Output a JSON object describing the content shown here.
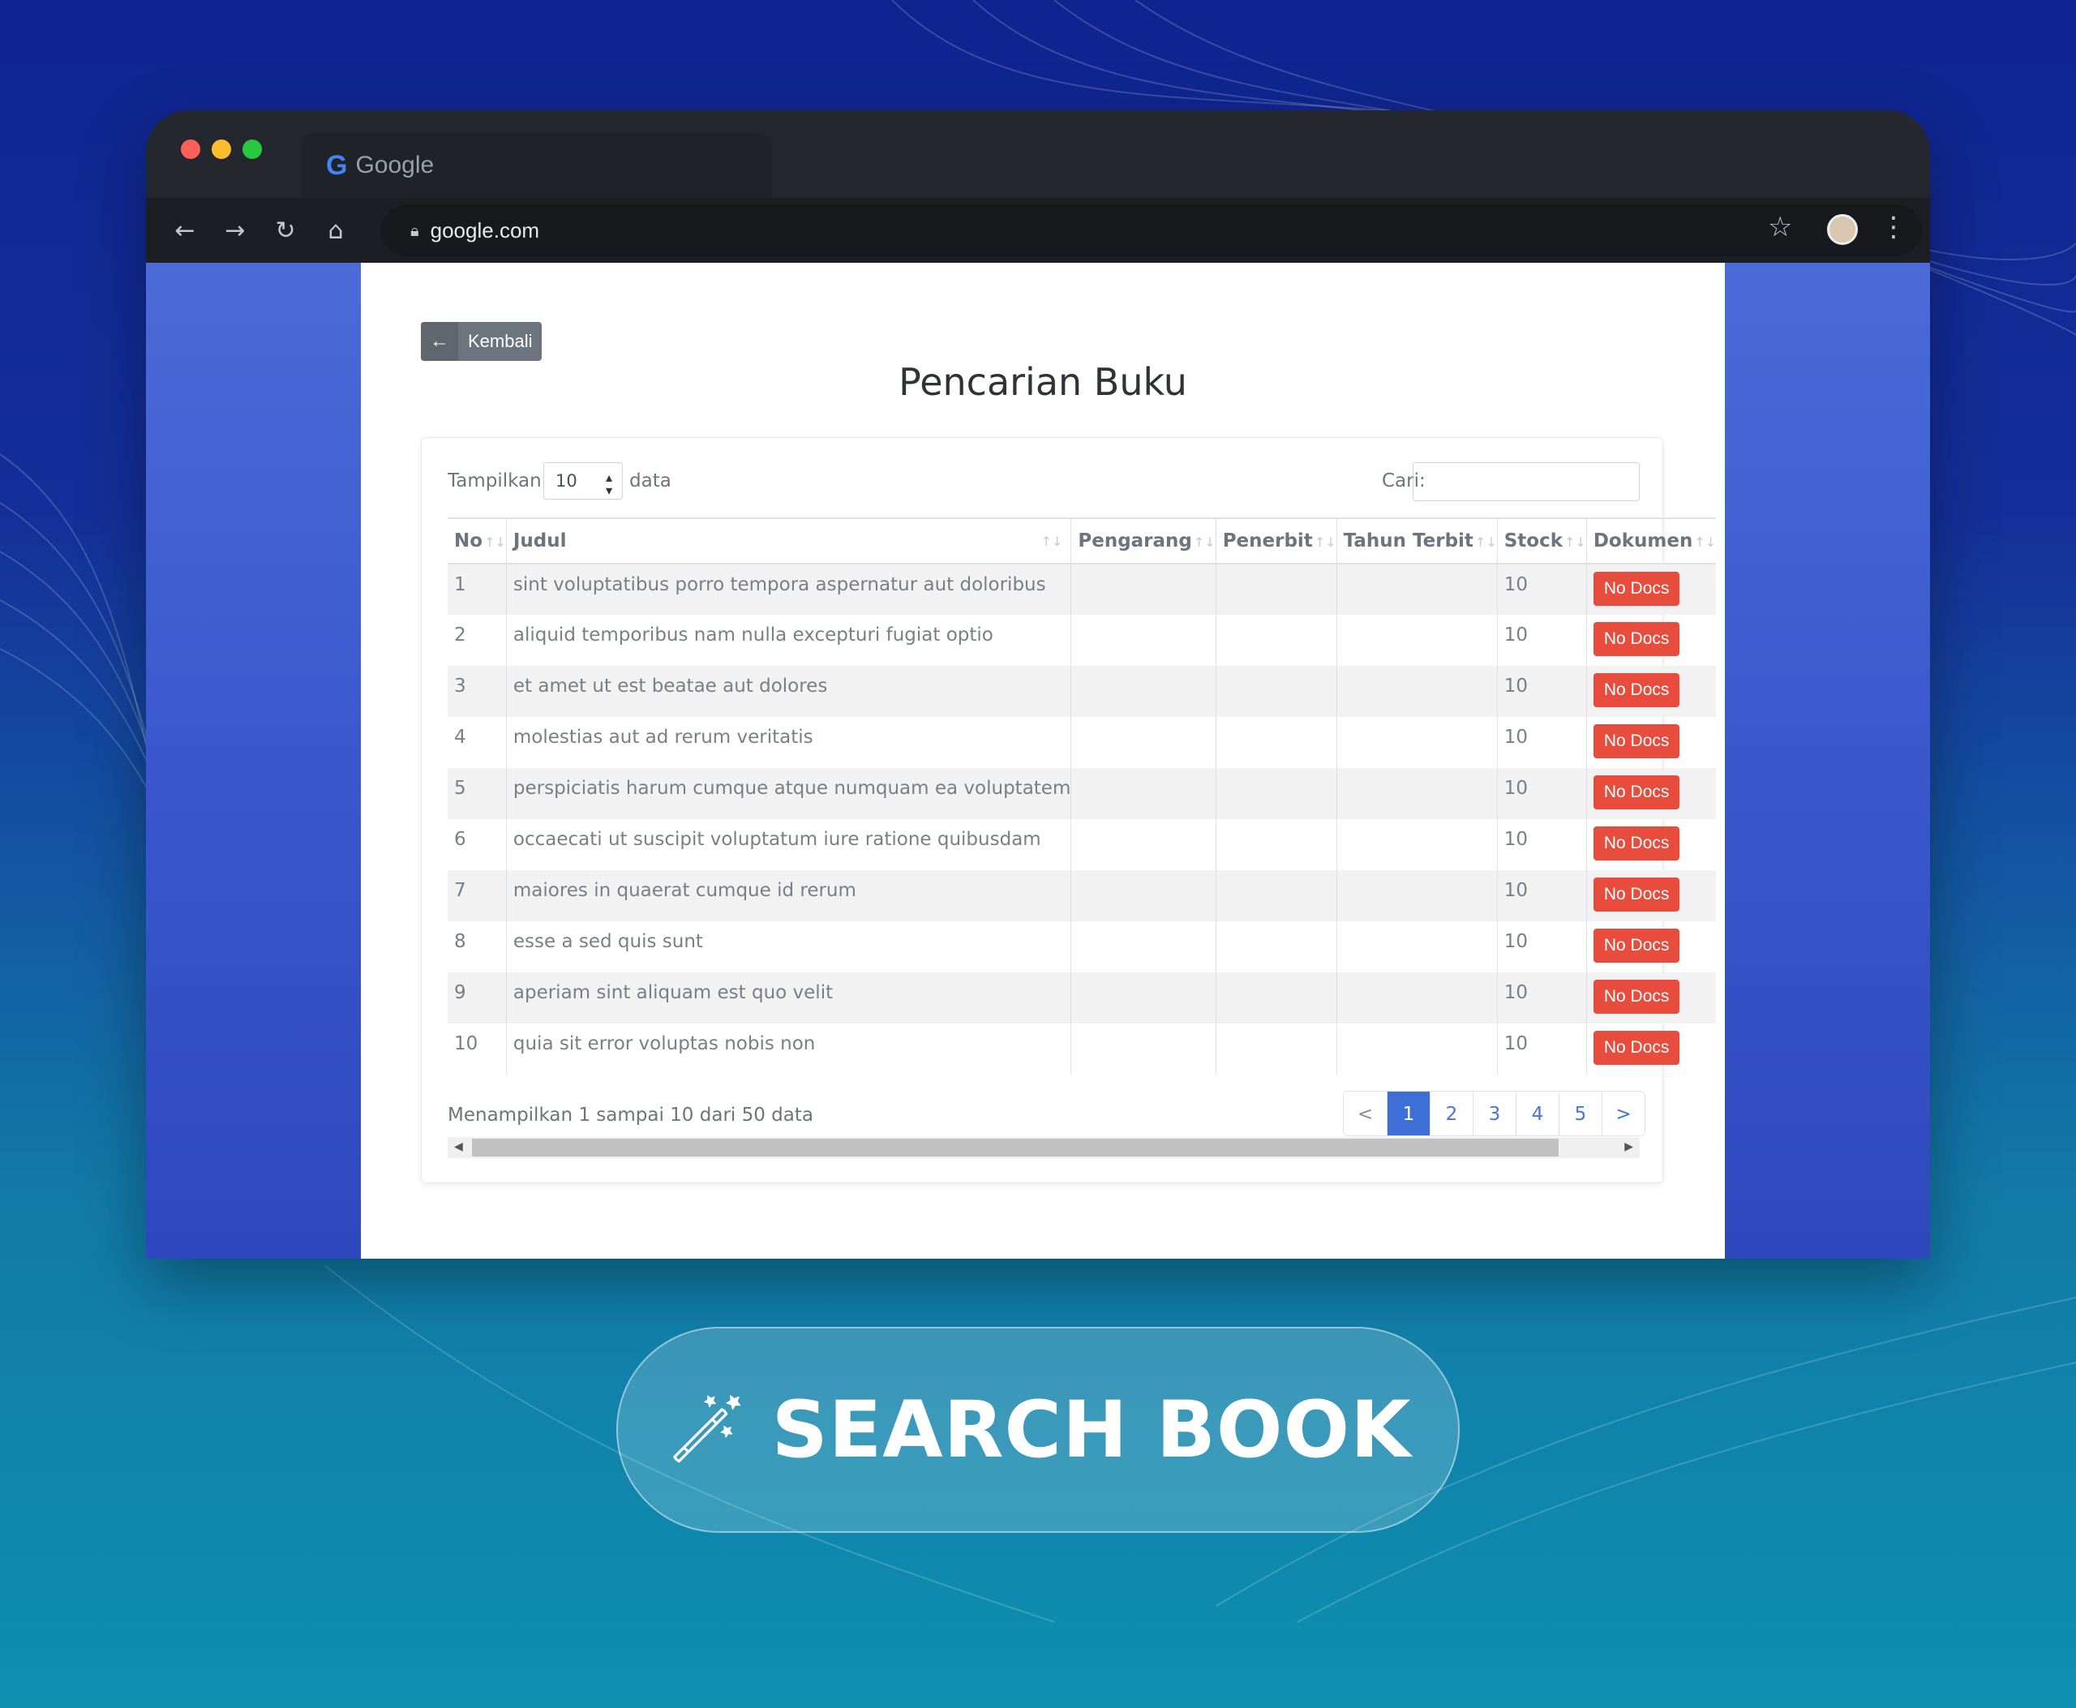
{
  "browser": {
    "tab_title": "Google",
    "g_logo": "G",
    "address": "google.com",
    "icons": [
      "back-arrow-icon",
      "forward-arrow-icon",
      "reload-icon",
      "home-icon",
      "lock-icon",
      "star-icon",
      "avatar",
      "kebab-menu-icon"
    ]
  },
  "page": {
    "back_label": "Kembali",
    "title": "Pencarian Buku"
  },
  "controls": {
    "show_label": "Tampilkan",
    "show_value": "10",
    "show_suffix": "data",
    "search_label": "Cari:",
    "search_value": ""
  },
  "table": {
    "columns": [
      "No",
      "Judul",
      "Pengarang",
      "Penerbit",
      "Tahun Terbit",
      "Stock",
      "Dokumen"
    ],
    "rows": [
      {
        "no": "1",
        "judul": "sint voluptatibus porro tempora aspernatur aut doloribus",
        "pengarang": "",
        "penerbit": "",
        "tahun": "",
        "stock": "10",
        "dokumen": "No Docs"
      },
      {
        "no": "2",
        "judul": "aliquid temporibus nam nulla excepturi fugiat optio",
        "pengarang": "",
        "penerbit": "",
        "tahun": "",
        "stock": "10",
        "dokumen": "No Docs"
      },
      {
        "no": "3",
        "judul": "et amet ut est beatae aut dolores",
        "pengarang": "",
        "penerbit": "",
        "tahun": "",
        "stock": "10",
        "dokumen": "No Docs"
      },
      {
        "no": "4",
        "judul": "molestias aut ad rerum veritatis",
        "pengarang": "",
        "penerbit": "",
        "tahun": "",
        "stock": "10",
        "dokumen": "No Docs"
      },
      {
        "no": "5",
        "judul": "perspiciatis harum cumque atque numquam ea voluptatem",
        "pengarang": "",
        "penerbit": "",
        "tahun": "",
        "stock": "10",
        "dokumen": "No Docs"
      },
      {
        "no": "6",
        "judul": "occaecati ut suscipit voluptatum iure ratione quibusdam",
        "pengarang": "",
        "penerbit": "",
        "tahun": "",
        "stock": "10",
        "dokumen": "No Docs"
      },
      {
        "no": "7",
        "judul": "maiores in quaerat cumque id rerum",
        "pengarang": "",
        "penerbit": "",
        "tahun": "",
        "stock": "10",
        "dokumen": "No Docs"
      },
      {
        "no": "8",
        "judul": "esse a sed quis sunt",
        "pengarang": "",
        "penerbit": "",
        "tahun": "",
        "stock": "10",
        "dokumen": "No Docs"
      },
      {
        "no": "9",
        "judul": "aperiam sint aliquam est quo velit",
        "pengarang": "",
        "penerbit": "",
        "tahun": "",
        "stock": "10",
        "dokumen": "No Docs"
      },
      {
        "no": "10",
        "judul": "quia sit error voluptas nobis non",
        "pengarang": "",
        "penerbit": "",
        "tahun": "",
        "stock": "10",
        "dokumen": "No Docs"
      }
    ]
  },
  "footer": {
    "info": "Menampilkan 1 sampai 10 dari 50 data",
    "pages": [
      "<",
      "1",
      "2",
      "3",
      "4",
      "5",
      ">"
    ],
    "active_page": "1"
  },
  "banner": {
    "text": "SEARCH BOOK",
    "icon": "magic-wand-icon"
  },
  "colors": {
    "danger": "#e74c3c",
    "primary": "#3e6fd6",
    "secondary": "#6c757d"
  }
}
